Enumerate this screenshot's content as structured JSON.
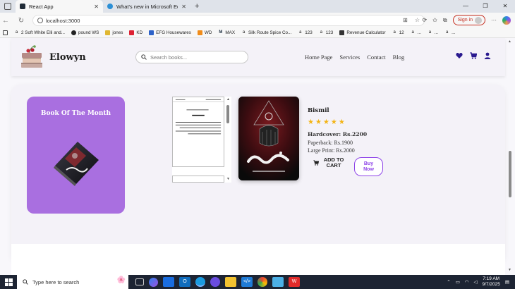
{
  "browser": {
    "tabs": [
      {
        "title": "React App",
        "active": true
      },
      {
        "title": "What's new in Microsoft Edge",
        "active": false
      }
    ],
    "url": "localhost:3000",
    "sign_in": "Sign in",
    "favorites": [
      {
        "label": "2 Soft White Elli and...",
        "icon": "amazon-icon"
      },
      {
        "label": "pound WS",
        "icon": "link-icon"
      },
      {
        "label": "jones",
        "icon": "folder-icon"
      },
      {
        "label": "KD",
        "icon": "kd-icon"
      },
      {
        "label": "EFG Housewares",
        "icon": "efg-icon"
      },
      {
        "label": "WD",
        "icon": "wd-icon"
      },
      {
        "label": "MAX",
        "icon": "max-icon"
      },
      {
        "label": "Silk Route Spice Co...",
        "icon": "amazon-icon"
      },
      {
        "label": "123",
        "icon": "amazon-icon"
      },
      {
        "label": "123",
        "icon": "amazon-icon"
      },
      {
        "label": "Revenue Calculator",
        "icon": "calc-icon"
      },
      {
        "label": "12",
        "icon": "amazon-icon"
      },
      {
        "label": "...",
        "icon": "amazon-icon"
      },
      {
        "label": "...",
        "icon": "amazon-icon"
      },
      {
        "label": "...",
        "icon": "amazon-icon"
      }
    ]
  },
  "site": {
    "brand": "Elowyn",
    "search_placeholder": "Search books...",
    "nav": [
      "Home Page",
      "Services",
      "Contact",
      "Blog"
    ]
  },
  "featured": {
    "section_title": "Book Of The Month",
    "book": {
      "title": "Bismil",
      "rating": 5,
      "hardcover_label": "Hardcover: Rs.2200",
      "paperback_label": "Paperback: Rs.1900",
      "largeprint_label": "Large Print: Rs.2000"
    },
    "add_to_cart": "ADD TO CART",
    "buy_now": "Buy Now"
  },
  "taskbar": {
    "search_placeholder": "Type here to search",
    "time": "7:19 AM",
    "date": "9/7/2025"
  },
  "colors": {
    "accent_purple": "#a96fe0",
    "button_purple": "#8e44e8",
    "icon_navy": "#2a1a8f",
    "star_gold": "#f3b415"
  }
}
